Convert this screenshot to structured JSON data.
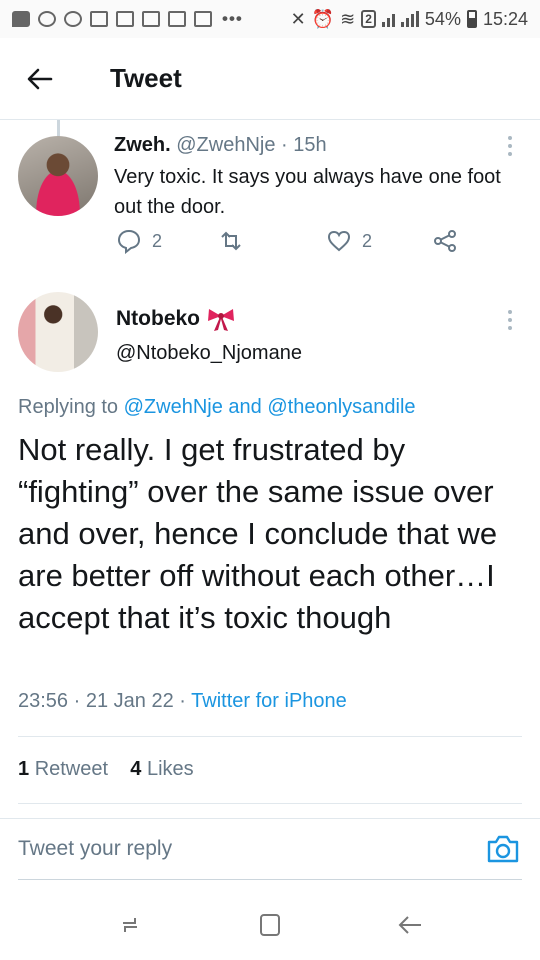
{
  "status_bar": {
    "battery": "54%",
    "time": "15:24",
    "notification_badge": "2"
  },
  "header": {
    "title": "Tweet"
  },
  "parent_tweet": {
    "name": "Zweh.",
    "handle": "@ZwehNje",
    "time": "15h",
    "text": "Very toxic. It says you always have one foot out the door.",
    "replies": "2",
    "likes": "2"
  },
  "main_tweet": {
    "name": "Ntobeko",
    "handle": "@Ntobeko_Njomane",
    "replying_prefix": "Replying to",
    "replying_to_1": "@ZwehNje",
    "replying_and": "and",
    "replying_to_2": "@theonlysandile",
    "text": "Not really. I get frustrated by “fighting” over the same issue over and over, hence I conclude that we are better off without each other…I accept that it’s toxic though",
    "time": "23:56",
    "date": "21 Jan 22",
    "source": "Twitter for iPhone",
    "retweets_count": "1",
    "retweets_label": "Retweet",
    "likes_count": "4",
    "likes_label": "Likes"
  },
  "reply_bar": {
    "placeholder": "Tweet your reply"
  },
  "colors": {
    "link": "#1b95e0",
    "muted": "#657786",
    "text": "#14171a",
    "divider": "#e1e8ed"
  }
}
